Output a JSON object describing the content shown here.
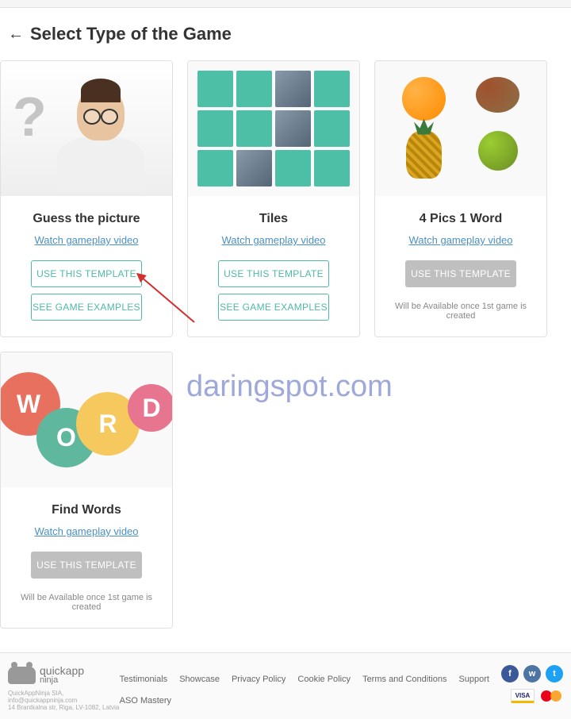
{
  "header": {
    "back_arrow": "←",
    "title": "Select Type of the Game"
  },
  "cards": [
    {
      "title": "Guess the picture",
      "watch_link": "Watch gameplay video",
      "use_template": "USE THIS TEMPLATE",
      "see_examples": "SEE GAME EXAMPLES",
      "available": true
    },
    {
      "title": "Tiles",
      "watch_link": "Watch gameplay video",
      "use_template": "USE THIS TEMPLATE",
      "see_examples": "SEE GAME EXAMPLES",
      "available": true
    },
    {
      "title": "4 Pics 1 Word",
      "watch_link": "Watch gameplay video",
      "use_template": "USE THIS TEMPLATE",
      "availability_note": "Will be Available once 1st game is created",
      "available": false
    },
    {
      "title": "Find Words",
      "watch_link": "Watch gameplay video",
      "use_template": "USE THIS TEMPLATE",
      "availability_note": "Will be Available once 1st game is created",
      "available": false
    }
  ],
  "watermark": "daringspot.com",
  "footer": {
    "logo_main": "quickapp",
    "logo_sub": "ninja",
    "company_line1": "QuickAppNinja SIA, info@quickappninja.com",
    "company_line2": "14 Brantkalna str, Riga, LV-1082, Latvia",
    "links": [
      "Testimonials",
      "Showcase",
      "Privacy Policy",
      "Cookie Policy",
      "Terms and Conditions",
      "Support",
      "ASO Mastery"
    ],
    "social": {
      "fb": "f",
      "vk": "w",
      "tw": "t"
    },
    "payment": {
      "visa": "VISA"
    }
  }
}
